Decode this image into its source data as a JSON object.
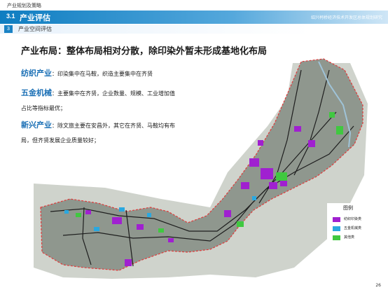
{
  "header": {
    "top_label": "产业规划及策略",
    "section_number": "3.1",
    "section_title": "产业评估",
    "right_title": "绍兴柯桥经济技术开发区总体规划研究",
    "sub_number": "3",
    "sub_title": "产业空间评估"
  },
  "main": {
    "headline": "产业布局：整体布局相对分散，除印染外暂未形成基地化布局",
    "items": [
      {
        "keyword": "纺织产业",
        "line1": "：印染集中在马鞍，织造主要集中在齐贤",
        "line2": ""
      },
      {
        "keyword": "五金机械",
        "line1": "：主要集中在齐贤，企业数量、规模、工业增加值",
        "line2": "占比等指标最优；"
      },
      {
        "keyword": "新兴产业",
        "line1": "：除文旅主要在安昌外，其它在齐贤、马鞍均有布",
        "line2": "局，但齐贤发展企业质量较好；"
      }
    ]
  },
  "legend": {
    "title": "图例",
    "items": [
      {
        "label": "纺织印染类",
        "color": "#a020d0"
      },
      {
        "label": "五金机械类",
        "color": "#2aa8e0"
      },
      {
        "label": "其他类",
        "color": "#40c840"
      }
    ]
  },
  "page_number": "26"
}
